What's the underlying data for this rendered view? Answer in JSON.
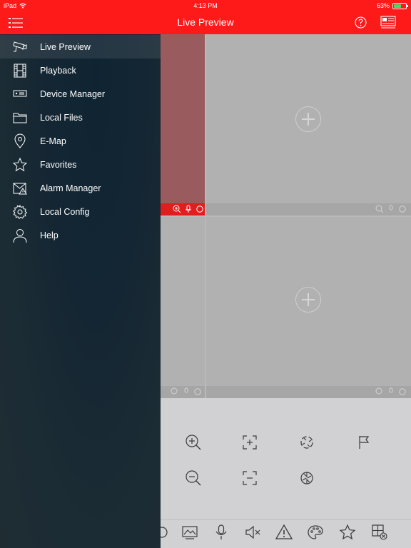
{
  "status_bar": {
    "device": "iPad",
    "time": "4:13 PM",
    "battery": "63%",
    "battery_level": 0.63
  },
  "nav": {
    "title": "Live Preview"
  },
  "sidebar": {
    "items": [
      {
        "label": "Live Preview",
        "icon": "camera-icon",
        "active": true
      },
      {
        "label": "Playback",
        "icon": "film-icon"
      },
      {
        "label": "Device Manager",
        "icon": "device-icon"
      },
      {
        "label": "Local Files",
        "icon": "folder-icon"
      },
      {
        "label": "E-Map",
        "icon": "map-pin-icon"
      },
      {
        "label": "Favorites",
        "icon": "star-icon"
      },
      {
        "label": "Alarm Manager",
        "icon": "alarm-icon"
      },
      {
        "label": "Local Config",
        "icon": "gear-icon"
      },
      {
        "label": "Help",
        "icon": "user-icon"
      }
    ]
  },
  "colors": {
    "brand": "#ff1a1a",
    "sidebar": "#1c2c34",
    "selected_window": "#e11e1e"
  },
  "controls": [
    "zoom-in-icon",
    "focus-near-icon",
    "iris-open-icon",
    "preset-flag-icon",
    "zoom-out-icon",
    "focus-far-icon",
    "iris-close-icon"
  ],
  "toolbar": [
    "snapshot-icon",
    "picture-icon",
    "microphone-icon",
    "audio-mute-icon",
    "alarm-warning-icon",
    "palette-icon",
    "star-icon",
    "window-close-icon"
  ]
}
